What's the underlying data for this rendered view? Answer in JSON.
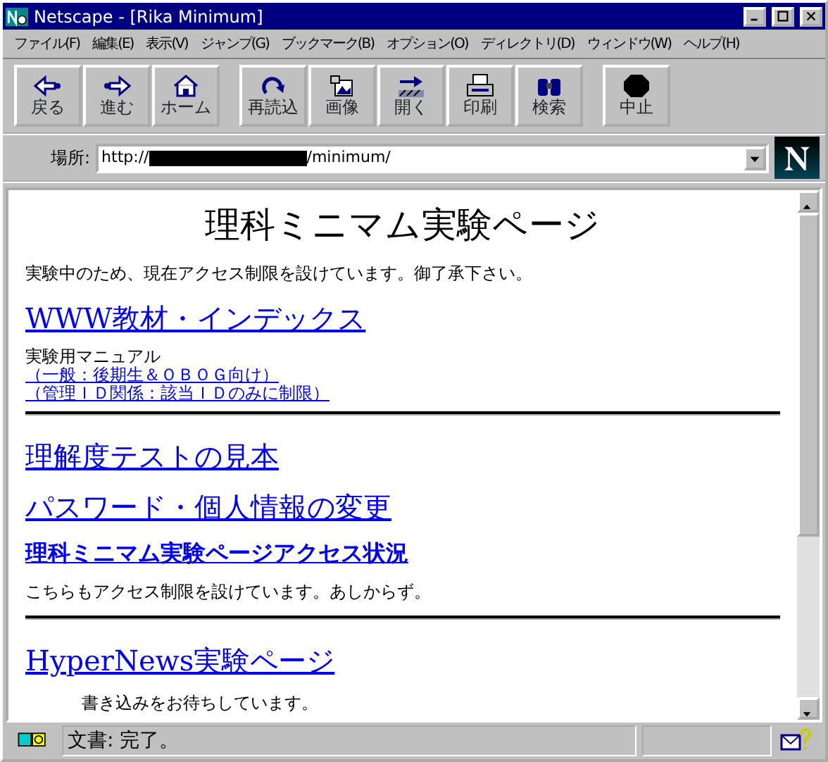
{
  "window": {
    "title": "Netscape - [Rika Minimum]"
  },
  "menu": [
    "ファイル(F)",
    "編集(E)",
    "表示(V)",
    "ジャンプ(G)",
    "ブックマーク(B)",
    "オプション(O)",
    "ディレクトリ(D)",
    "ウィンドウ(W)",
    "ヘルプ(H)"
  ],
  "toolbar": [
    [
      {
        "label": "戻る",
        "kind": "back"
      },
      {
        "label": "進む",
        "kind": "forward"
      },
      {
        "label": "ホーム",
        "kind": "home"
      }
    ],
    [
      {
        "label": "再読込",
        "kind": "reload"
      },
      {
        "label": "画像",
        "kind": "images"
      },
      {
        "label": "開く",
        "kind": "open"
      },
      {
        "label": "印刷",
        "kind": "print"
      },
      {
        "label": "検索",
        "kind": "find"
      }
    ],
    [
      {
        "label": "中止",
        "kind": "stop"
      }
    ]
  ],
  "location": {
    "label": "場所:",
    "prefix": "http://",
    "suffix": "/minimum/"
  },
  "content": [
    {
      "kind": "title",
      "text": "理科ミニマム実験ページ"
    },
    {
      "kind": "text",
      "text": "実験中のため、現在アクセス制限を設けています。御了承下さい。"
    },
    {
      "kind": "link-large",
      "text": "WWW教材・インデックス"
    },
    {
      "kind": "line",
      "text": "実験用マニュアル"
    },
    {
      "kind": "link-small",
      "text": "（一般：後期生＆ＯＢＯＧ向け）"
    },
    {
      "kind": "link-small",
      "text": "（管理ＩＤ関係：該当ＩＤのみに制限）"
    },
    {
      "kind": "rule"
    },
    {
      "kind": "link-large",
      "text": "理解度テストの見本"
    },
    {
      "kind": "link-large",
      "text": "パスワード・個人情報の変更"
    },
    {
      "kind": "link-medium",
      "text": "理科ミニマム実験ページアクセス状況"
    },
    {
      "kind": "text",
      "text": "こちらもアクセス制限を設けています。あしからず。"
    },
    {
      "kind": "rule"
    },
    {
      "kind": "link-large",
      "text": "HyperNews実験ページ"
    },
    {
      "kind": "indent",
      "text": "書き込みをお待ちしています。"
    }
  ],
  "status_bar": {
    "text": "文書: 完了。"
  }
}
